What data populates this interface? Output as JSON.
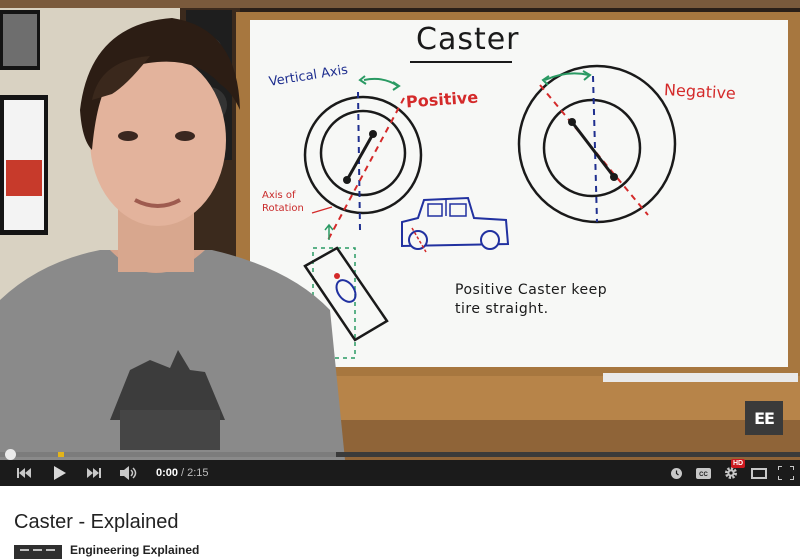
{
  "player": {
    "whiteboard": {
      "title": "Caster",
      "vertical_axis_label": "Vertical Axis",
      "positive_label": "Positive",
      "negative_label": "Negative",
      "axis_of_rotation_label": "Axis of\nRotation",
      "note": "Positive Caster keep\ntire straight."
    },
    "channel_logo_text": "EE",
    "progress": {
      "played_fraction": 0.0,
      "loaded_fraction": 0.42
    },
    "time": {
      "current": "0:00",
      "separator": "/",
      "duration": "2:15"
    },
    "hd_badge": "HD",
    "cc_label": "CC",
    "colors": {
      "accent": "#cc181e",
      "controls_bg": "#1b1b1b",
      "buffer_marker": "#e3b41a"
    },
    "icons": [
      "previous-icon",
      "play-icon",
      "next-icon",
      "volume-icon",
      "watch-later-icon",
      "captions-icon",
      "settings-icon",
      "theater-mode-icon",
      "fullscreen-icon"
    ]
  },
  "video": {
    "title": "Caster - Explained",
    "channel": "Engineering Explained"
  }
}
